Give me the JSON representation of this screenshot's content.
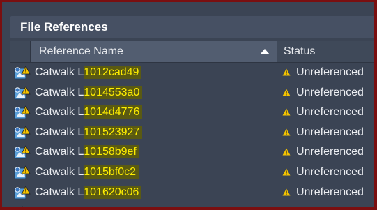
{
  "panel": {
    "title": "File References"
  },
  "columns": {
    "name": "Reference Name",
    "status": "Status"
  },
  "rows": [
    {
      "prefix": "Catwalk L",
      "highlight": "1012cad49",
      "status": "Unreferenced"
    },
    {
      "prefix": "Catwalk L",
      "highlight": "1014553a0",
      "status": "Unreferenced"
    },
    {
      "prefix": "Catwalk L",
      "highlight": "1014d4776",
      "status": "Unreferenced"
    },
    {
      "prefix": "Catwalk L",
      "highlight": "101523927",
      "status": "Unreferenced"
    },
    {
      "prefix": "Catwalk L",
      "highlight": "10158b9ef",
      "status": "Unreferenced"
    },
    {
      "prefix": "Catwalk L",
      "highlight": "1015bf0c2",
      "status": "Unreferenced"
    },
    {
      "prefix": "Catwalk L",
      "highlight": "101620c06",
      "status": "Unreferenced"
    }
  ],
  "colors": {
    "border": "#7a0f10",
    "panel_bg": "#3b4454",
    "highlight_text": "#ffee00",
    "warning": "#f5c400"
  },
  "icons": {
    "file": "xref-file-warning-icon",
    "status": "warning-icon"
  }
}
